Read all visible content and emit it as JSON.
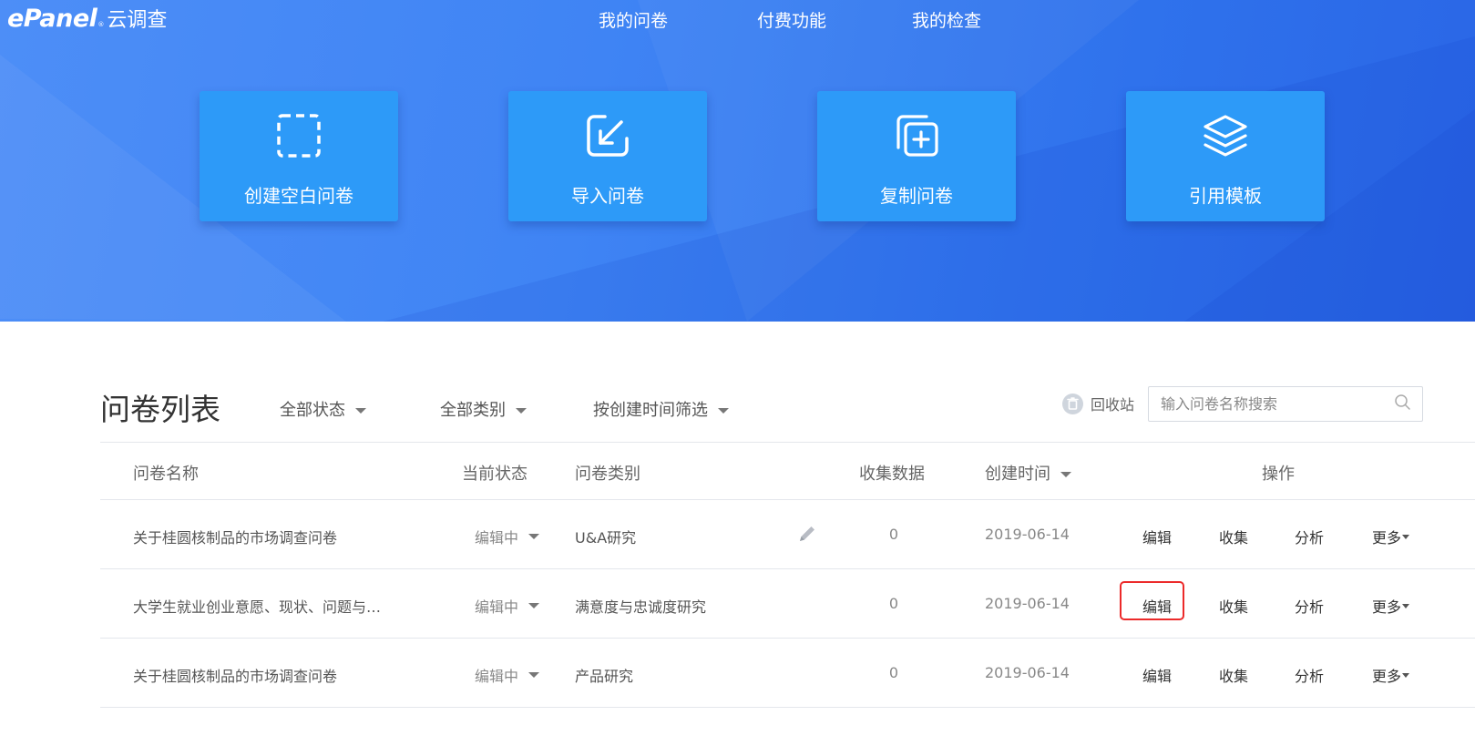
{
  "header": {
    "logo_brand": "ePanel",
    "logo_mark": "®",
    "logo_cn": "云调查",
    "nav": [
      "我的问卷",
      "付费功能",
      "我的检查"
    ]
  },
  "actions": [
    {
      "label": "创建空白问卷",
      "icon": "dashed-square-icon"
    },
    {
      "label": "导入问卷",
      "icon": "import-arrow-icon"
    },
    {
      "label": "复制问卷",
      "icon": "copy-plus-icon"
    },
    {
      "label": "引用模板",
      "icon": "layers-icon"
    }
  ],
  "list": {
    "title": "问卷列表",
    "filters": [
      "全部状态",
      "全部类别",
      "按创建时间筛选"
    ],
    "recycle_label": "回收站",
    "search_placeholder": "输入问卷名称搜索",
    "headers": {
      "name": "问卷名称",
      "status": "当前状态",
      "category": "问卷类别",
      "count": "收集数据",
      "created": "创建时间",
      "ops": "操作"
    },
    "rows": [
      {
        "name": "关于桂圆核制品的市场调查问卷",
        "status": "编辑中",
        "category": "U&A研究",
        "count": "0",
        "created": "2019-06-14"
      },
      {
        "name": "大学生就业创业意愿、现状、问题与…",
        "status": "编辑中",
        "category": "满意度与忠诚度研究",
        "count": "0",
        "created": "2019-06-14"
      },
      {
        "name": "关于桂圆核制品的市场调查问卷",
        "status": "编辑中",
        "category": "产品研究",
        "count": "0",
        "created": "2019-06-14"
      }
    ],
    "ops": {
      "edit": "编辑",
      "collect": "收集",
      "analyze": "分析",
      "more": "更多"
    }
  },
  "colors": {
    "hero": "#3f84f4",
    "card": "#2d9af8",
    "highlight": "#ec2a2a"
  }
}
